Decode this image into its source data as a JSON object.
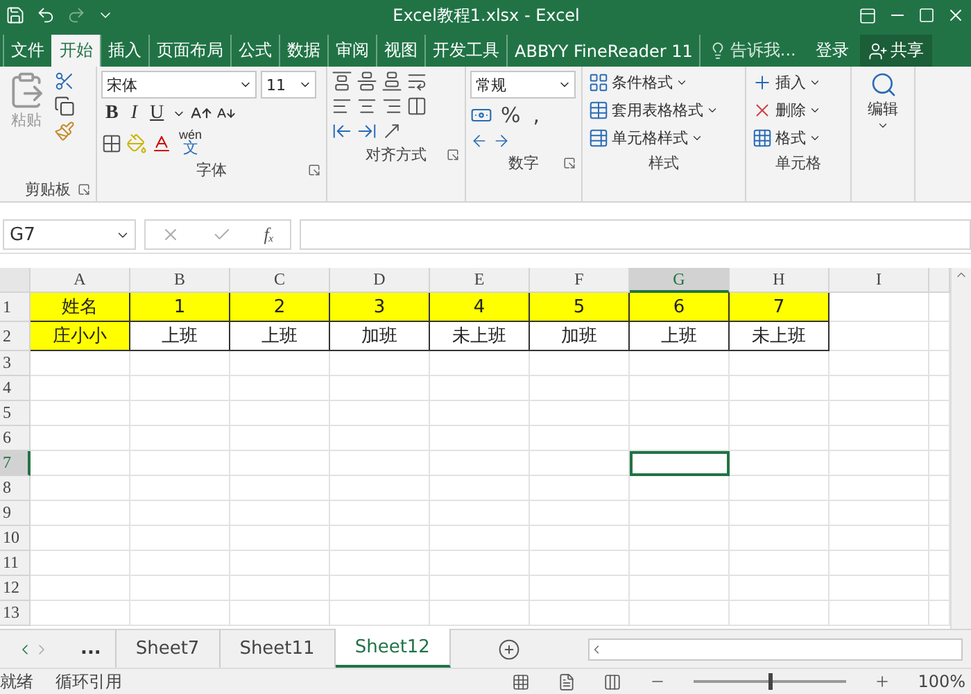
{
  "window": {
    "title": "Excel教程1.xlsx - Excel"
  },
  "ribbon_tabs": [
    {
      "label": "文件",
      "selected": false
    },
    {
      "label": "开始",
      "selected": true
    },
    {
      "label": "插入",
      "selected": false
    },
    {
      "label": "页面布局",
      "selected": false
    },
    {
      "label": "公式",
      "selected": false
    },
    {
      "label": "数据",
      "selected": false
    },
    {
      "label": "审阅",
      "selected": false
    },
    {
      "label": "视图",
      "selected": false
    },
    {
      "label": "开发工具",
      "selected": false
    },
    {
      "label": "ABBYY FineReader 11",
      "selected": false
    }
  ],
  "tell_me": {
    "placeholder": "告诉我..."
  },
  "sign_in": "登录",
  "share": "共享",
  "ribbon": {
    "clipboard": {
      "label": "剪贴板",
      "paste": {
        "label": "粘贴",
        "disabled": true
      }
    },
    "font": {
      "label": "字体",
      "name": "宋体",
      "size": "11",
      "styles": [
        "B",
        "I",
        "U"
      ],
      "phonetic": {
        "top": "wén",
        "bottom": "文"
      }
    },
    "alignment": {
      "label": "对齐方式"
    },
    "number": {
      "label": "数字",
      "format": "常规",
      "symbols": [
        "%",
        ","
      ]
    },
    "styles": {
      "label": "样式",
      "items": [
        "条件格式",
        "套用表格格式",
        "单元格样式"
      ]
    },
    "cells": {
      "label": "单元格",
      "items": [
        "插入",
        "删除",
        "格式"
      ]
    },
    "editing": {
      "label": "编辑"
    }
  },
  "name_box": "G7",
  "function_button": "fₓ",
  "columns": [
    {
      "label": "A",
      "selected": false
    },
    {
      "label": "B",
      "selected": false
    },
    {
      "label": "C",
      "selected": false
    },
    {
      "label": "D",
      "selected": false
    },
    {
      "label": "E",
      "selected": false
    },
    {
      "label": "F",
      "selected": false
    },
    {
      "label": "G",
      "selected": true
    },
    {
      "label": "H",
      "selected": false
    },
    {
      "label": "I",
      "selected": false
    }
  ],
  "rows": [
    {
      "header": "1",
      "selected": false,
      "cells": [
        {
          "text": "姓名",
          "highlighted": true
        },
        {
          "text": "1",
          "highlighted": true
        },
        {
          "text": "2",
          "highlighted": true
        },
        {
          "text": "3",
          "highlighted": true
        },
        {
          "text": "4",
          "highlighted": true
        },
        {
          "text": "5",
          "highlighted": true
        },
        {
          "text": "6",
          "highlighted": true
        },
        {
          "text": "7",
          "highlighted": true
        }
      ]
    },
    {
      "header": "2",
      "selected": false,
      "cells": [
        {
          "text": "庄小小",
          "highlighted": true
        },
        {
          "text": "上班",
          "highlighted": false
        },
        {
          "text": "上班",
          "highlighted": false
        },
        {
          "text": "加班",
          "highlighted": false
        },
        {
          "text": "未上班",
          "highlighted": false
        },
        {
          "text": "加班",
          "highlighted": false
        },
        {
          "text": "上班",
          "highlighted": false
        },
        {
          "text": "未上班",
          "highlighted": false
        }
      ]
    },
    {
      "header": "3",
      "selected": false
    },
    {
      "header": "4",
      "selected": false
    },
    {
      "header": "5",
      "selected": false
    },
    {
      "header": "6",
      "selected": false
    },
    {
      "header": "7",
      "selected": true
    },
    {
      "header": "8",
      "selected": false
    },
    {
      "header": "9",
      "selected": false
    },
    {
      "header": "10",
      "selected": false
    },
    {
      "header": "11",
      "selected": false
    },
    {
      "header": "12",
      "selected": false
    },
    {
      "header": "13",
      "selected": false
    }
  ],
  "sheet_tabs": {
    "more": "...",
    "tabs": [
      {
        "label": "Sheet7",
        "selected": false
      },
      {
        "label": "Sheet11",
        "selected": false
      },
      {
        "label": "Sheet12",
        "selected": true
      }
    ]
  },
  "status_bar": {
    "items": [
      "就绪",
      "循环引用"
    ],
    "zoom": {
      "level": 0.5,
      "reading": "100%"
    }
  }
}
